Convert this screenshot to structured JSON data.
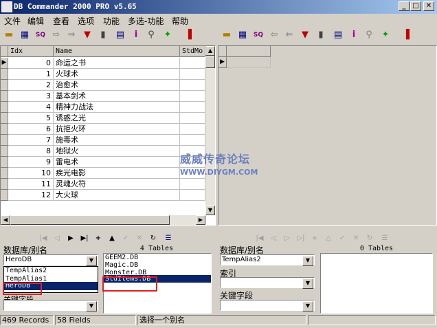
{
  "window": {
    "title": "DB Commander 2000 PRO v5.65",
    "minimize": "_",
    "maximize": "□",
    "close": "✕"
  },
  "menu": [
    "文件",
    "编辑",
    "查看",
    "选项",
    "功能",
    "多选-功能",
    "帮助"
  ],
  "left_grid": {
    "columns": [
      "Idx",
      "Name",
      "StdMo"
    ],
    "rows": [
      {
        "idx": "0",
        "name": "命运之书"
      },
      {
        "idx": "1",
        "name": "火球术"
      },
      {
        "idx": "2",
        "name": "治愈术"
      },
      {
        "idx": "3",
        "name": "基本剑术"
      },
      {
        "idx": "4",
        "name": "精神力战法"
      },
      {
        "idx": "5",
        "name": "诱惑之光"
      },
      {
        "idx": "6",
        "name": "抗拒火环"
      },
      {
        "idx": "7",
        "name": "施毒术"
      },
      {
        "idx": "8",
        "name": "地狱火"
      },
      {
        "idx": "9",
        "name": "雷电术"
      },
      {
        "idx": "10",
        "name": "疾光电影"
      },
      {
        "idx": "11",
        "name": "灵魂火符"
      },
      {
        "idx": "12",
        "name": "大火球"
      }
    ],
    "current_row_marker": "▶"
  },
  "left_panel": {
    "db_label": "数据库/别名",
    "db_value": "HeroDB",
    "db_options": [
      "TempAlias2",
      "TempAlias1",
      "HeroDB"
    ],
    "tables_count": "4 Tables",
    "tables": [
      "GEEM2.DB",
      "Magic.DB",
      "Monster.DB",
      "StdItems.DB"
    ],
    "selected_table": "StdItems.DB",
    "field_label": "关键字段"
  },
  "right_panel": {
    "db_label": "数据库/别名",
    "db_value": "TempAlias2",
    "tables_count": "0 Tables",
    "index_label": "索引",
    "field_label": "关键字段"
  },
  "status": {
    "records": "469 Records",
    "fields": "58 Fields",
    "message": "选择一个别名"
  },
  "watermark": {
    "line1": "威威传奇论坛",
    "line2": "WWW.DIYGM.COM"
  },
  "colors": {
    "title_bar": "#0a246a",
    "selection": "#0a246a",
    "highlight_box": "#e02020",
    "watermark": "#6b7fc0"
  }
}
